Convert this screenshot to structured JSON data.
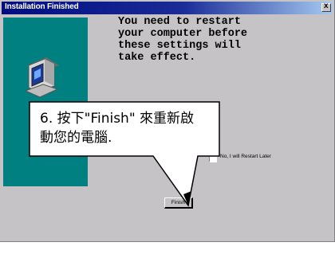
{
  "window": {
    "title": "Installation Finished",
    "close_glyph": "x"
  },
  "message": "You need to restart\nyour computer before\nthese settings will\ntake effect.",
  "checkbox": {
    "label": "No, I will Restart Later",
    "checked": false
  },
  "finish_button": {
    "label": "Finish"
  },
  "callout": {
    "line1": "6. 按下\"Finish\" 來重新啟",
    "line2": "動您的電腦."
  },
  "colors": {
    "titlebar_start": "#000c80",
    "titlebar_end": "#a6caf0",
    "side_panel": "#008080",
    "window_face": "#c6c3c6"
  },
  "icons": [
    "computer-icon",
    "close-icon",
    "arrow-icon"
  ]
}
